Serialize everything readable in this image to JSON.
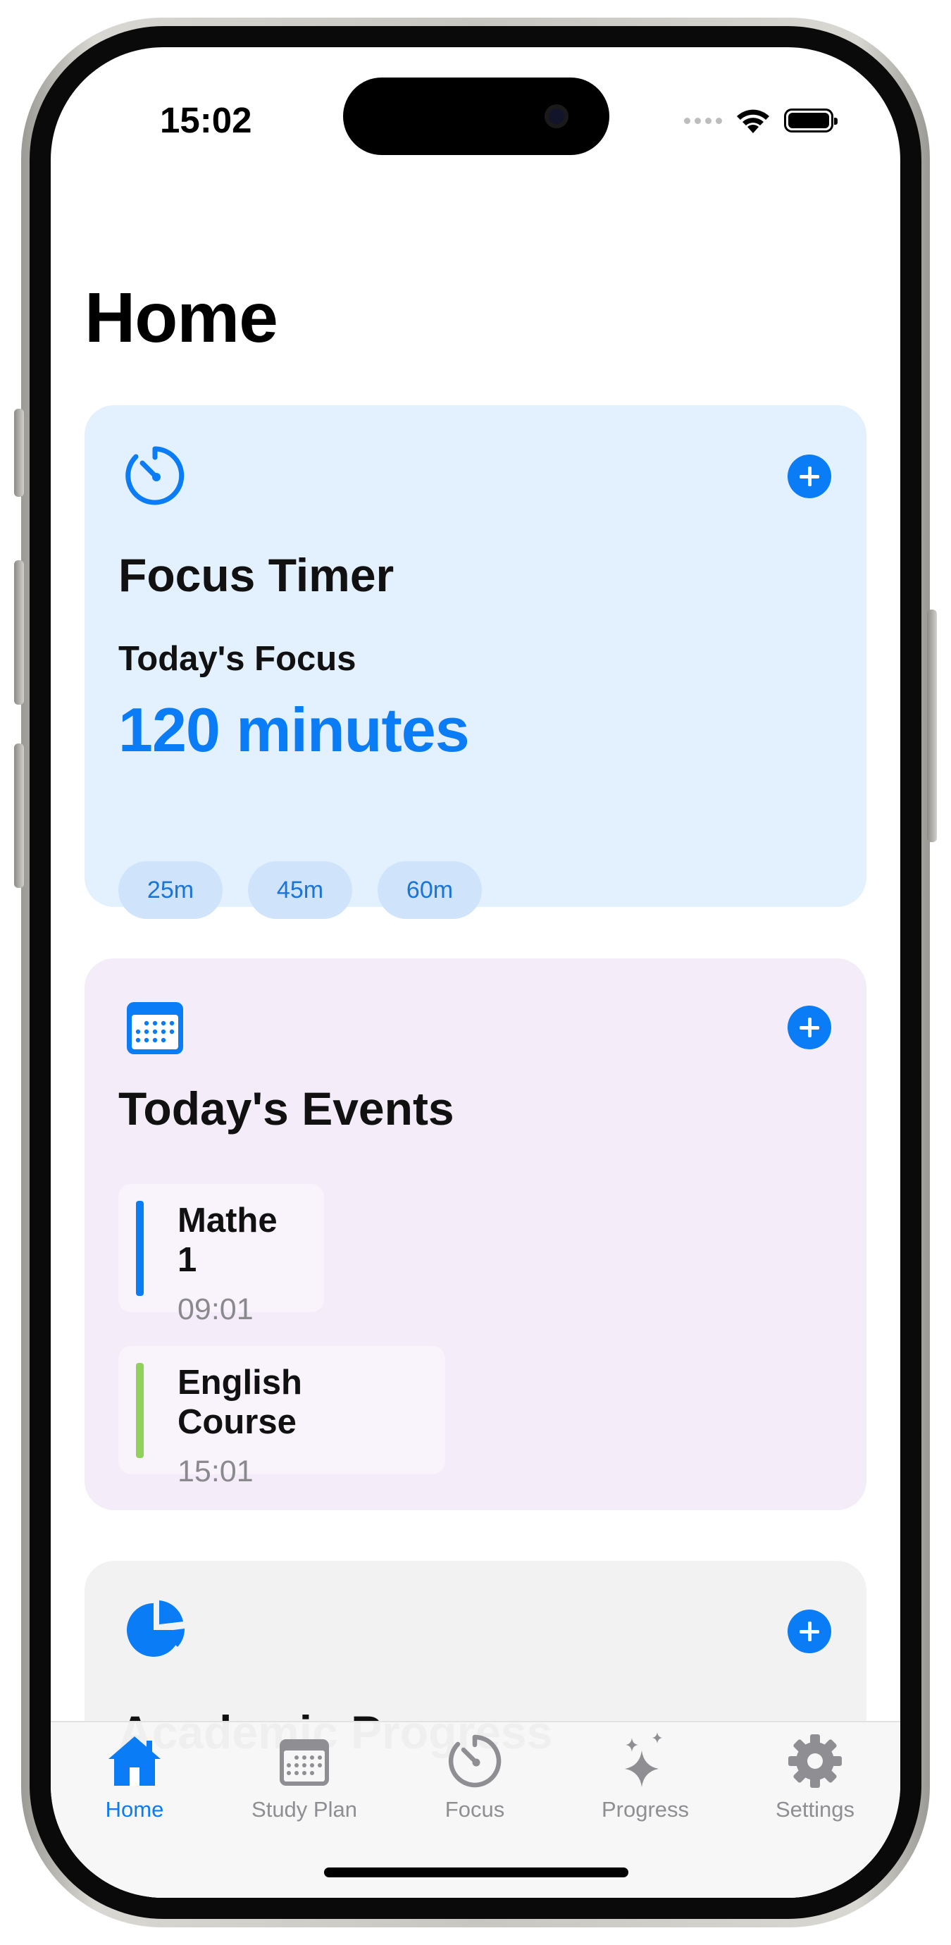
{
  "status_bar": {
    "time": "15:02"
  },
  "page": {
    "title": "Home"
  },
  "focus_card": {
    "title": "Focus Timer",
    "subtitle": "Today's Focus",
    "value": "120 minutes",
    "presets": [
      "25m",
      "45m",
      "60m"
    ]
  },
  "events_card": {
    "title": "Today's Events",
    "events": [
      {
        "name": "Mathe 1",
        "time": "09:01",
        "color": "#0a7cf5"
      },
      {
        "name": "English Course",
        "time": "15:01",
        "color": "#8ed15b"
      }
    ]
  },
  "progress_card": {
    "title": "Academic Progress"
  },
  "tab_bar": {
    "items": [
      {
        "label": "Home",
        "icon": "house-icon",
        "active": true
      },
      {
        "label": "Study Plan",
        "icon": "calendar-icon",
        "active": false
      },
      {
        "label": "Focus",
        "icon": "timer-icon",
        "active": false
      },
      {
        "label": "Progress",
        "icon": "sparkles-icon",
        "active": false
      },
      {
        "label": "Settings",
        "icon": "gear-icon",
        "active": false
      }
    ]
  },
  "colors": {
    "accent": "#0a7cf5",
    "focus_card_bg": "#e3f0fd",
    "events_card_bg": "#f4ecf9",
    "progress_card_bg": "#f2f2f2"
  }
}
